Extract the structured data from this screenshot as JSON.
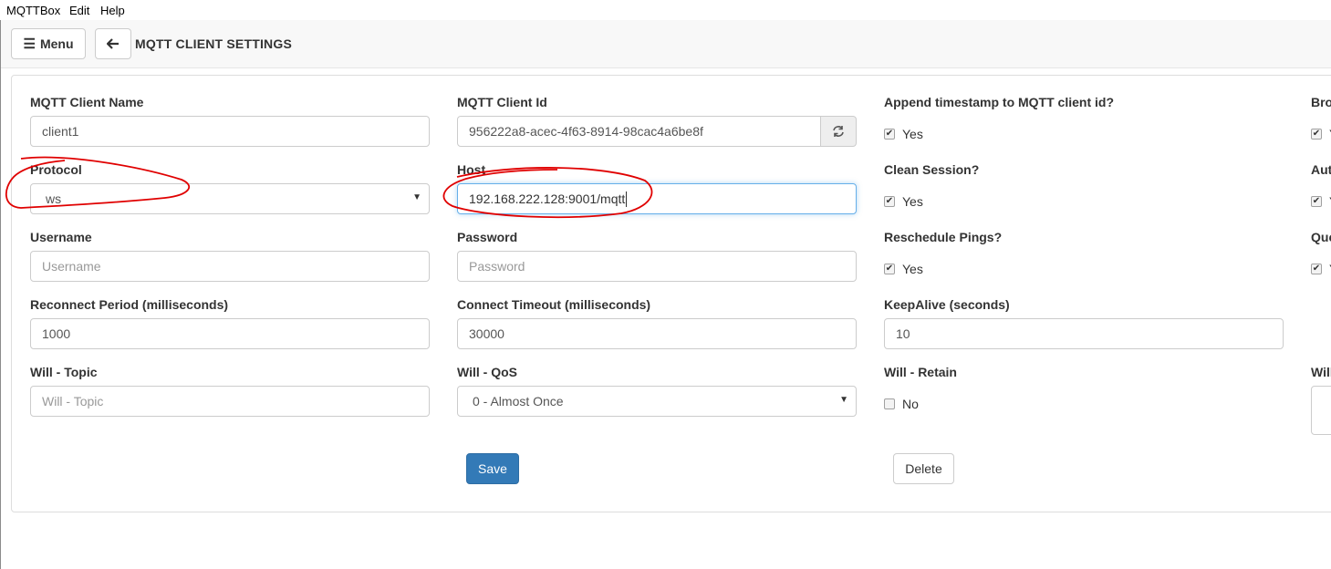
{
  "menubar": {
    "items": [
      "MQTTBox",
      "Edit",
      "Help"
    ]
  },
  "header": {
    "menu_label": "Menu",
    "title": "MQTT CLIENT SETTINGS"
  },
  "form": {
    "client_name": {
      "label": "MQTT Client Name",
      "value": "client1"
    },
    "client_id": {
      "label": "MQTT Client Id",
      "value": "956222a8-acec-4f63-8914-98cac4a6be8f"
    },
    "append_timestamp": {
      "label": "Append timestamp to MQTT client id?",
      "option": "Yes",
      "checked": true
    },
    "broker_cut": {
      "label": "Bro",
      "option": "Y",
      "checked": true
    },
    "protocol": {
      "label": "Protocol",
      "value": "ws"
    },
    "host": {
      "label": "Host",
      "value": "192.168.222.128:9001/mqtt"
    },
    "clean_session": {
      "label": "Clean Session?",
      "option": "Yes",
      "checked": true
    },
    "auto_cut": {
      "label": "Aut",
      "option": "Y",
      "checked": true
    },
    "username": {
      "label": "Username",
      "placeholder": "Username"
    },
    "password": {
      "label": "Password",
      "placeholder": "Password"
    },
    "reschedule_pings": {
      "label": "Reschedule Pings?",
      "option": "Yes",
      "checked": true
    },
    "queue_cut": {
      "label": "Que",
      "option": "Y",
      "checked": true
    },
    "reconnect_period": {
      "label": "Reconnect Period (milliseconds)",
      "value": "1000"
    },
    "connect_timeout": {
      "label": "Connect Timeout (milliseconds)",
      "value": "30000"
    },
    "keepalive": {
      "label": "KeepAlive (seconds)",
      "value": "10"
    },
    "will_topic": {
      "label": "Will - Topic",
      "placeholder": "Will - Topic"
    },
    "will_qos": {
      "label": "Will - QoS",
      "value": "0 - Almost Once"
    },
    "will_retain": {
      "label": "Will - Retain",
      "option": "No",
      "checked": false
    },
    "will_payload_cut": {
      "label": "Will"
    }
  },
  "actions": {
    "save_label": "Save",
    "delete_label": "Delete"
  },
  "colors": {
    "primary": "#337ab7",
    "annotation": "#e00000",
    "focus_border": "#66afe9"
  }
}
